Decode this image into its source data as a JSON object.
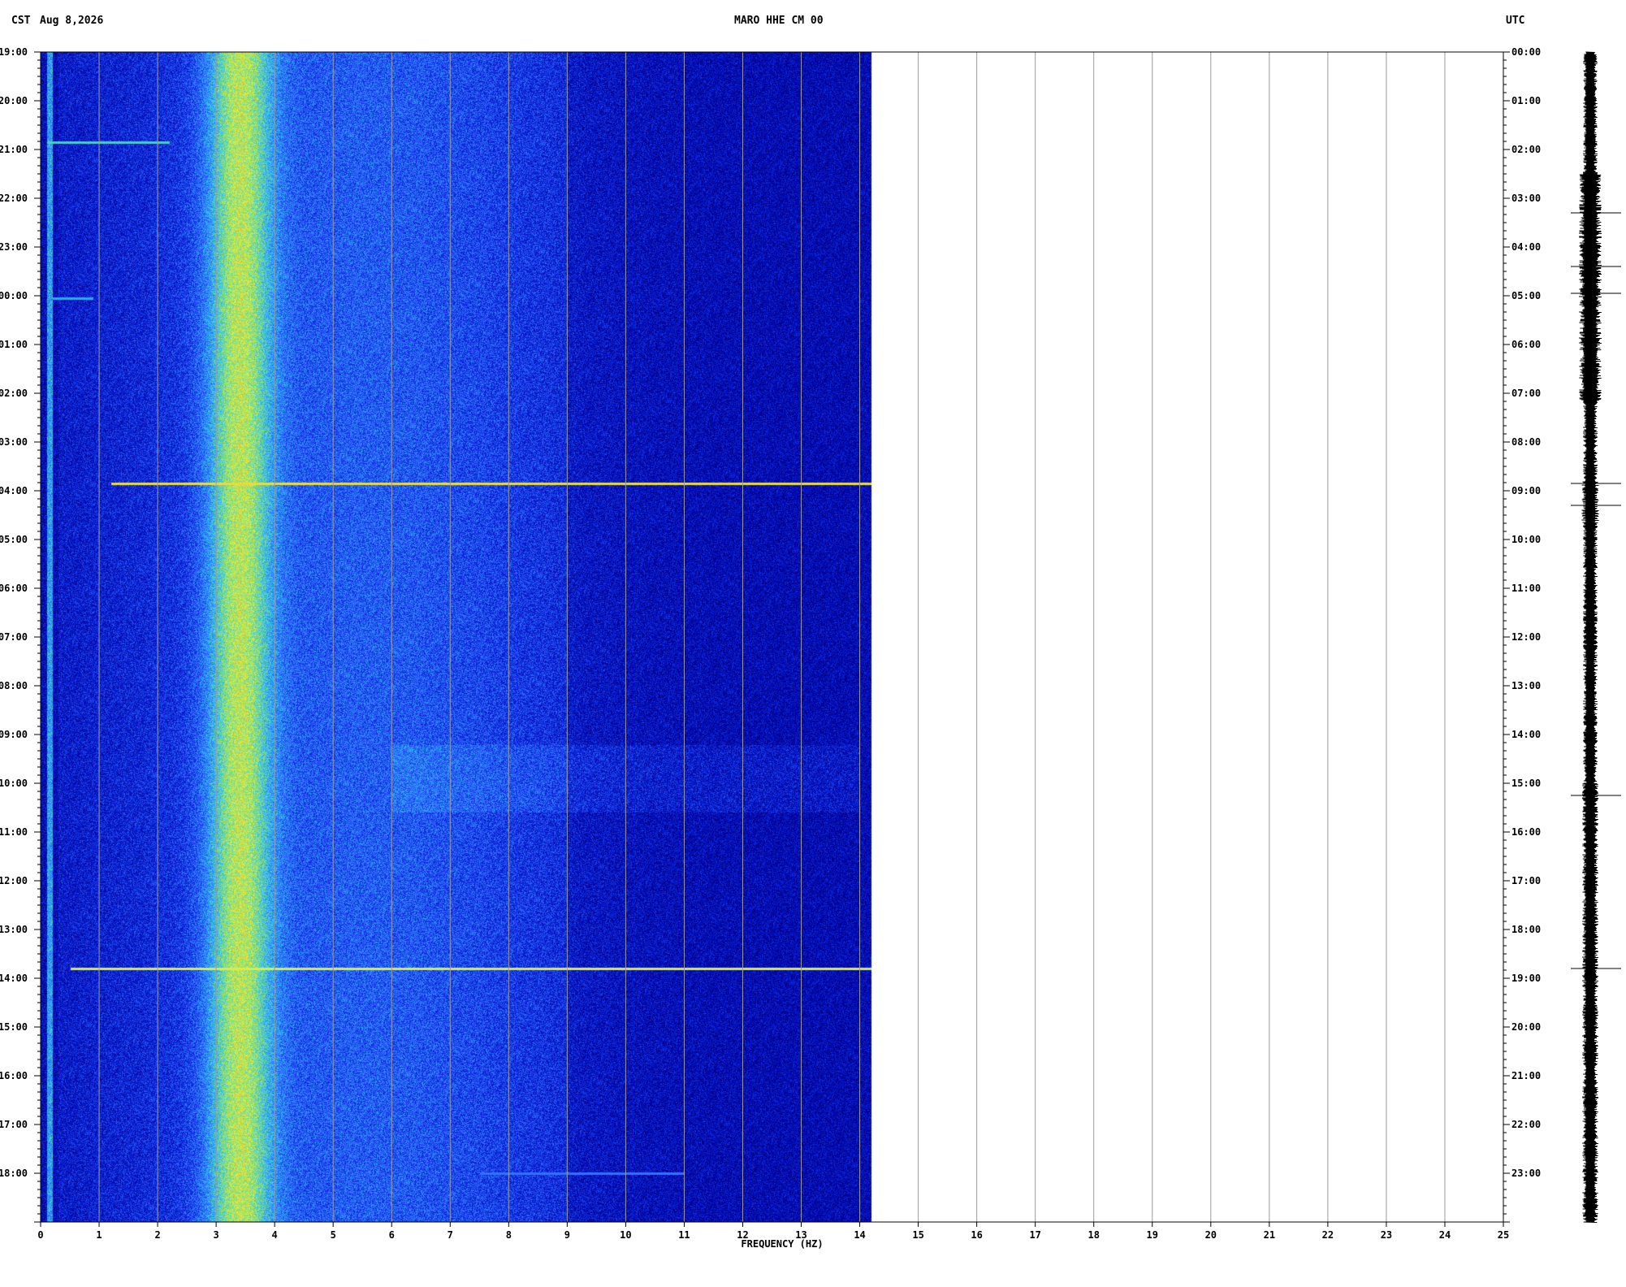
{
  "header": {
    "left_timezone": "CST",
    "date": "Aug 8,2026",
    "station": "MARO HHE CM 00",
    "right_timezone": "UTC"
  },
  "colors": {
    "background": "#ffffff",
    "axis": "#000000",
    "grid": "#9a9a9a",
    "colormap": [
      "#00008c",
      "#0a1fd8",
      "#2f6bff",
      "#30c0f0",
      "#8fe070",
      "#e8f040",
      "#ff2a10"
    ]
  },
  "chart_data": {
    "type": "heatmap",
    "subtype": "spectrogram",
    "title": "MARO HHE CM 00",
    "xlabel": "FREQUENCY (HZ)",
    "x_range": [
      0,
      25
    ],
    "x_ticks": [
      0,
      1,
      2,
      3,
      4,
      5,
      6,
      7,
      8,
      9,
      10,
      11,
      12,
      13,
      14,
      15,
      16,
      17,
      18,
      19,
      20,
      21,
      22,
      23,
      24,
      25
    ],
    "data_max_frequency_hz": 14.2,
    "y_left_label": "CST",
    "y_right_label": "UTC",
    "y_left_ticks": [
      "19:00",
      "20:00",
      "21:00",
      "22:00",
      "23:00",
      "00:00",
      "01:00",
      "02:00",
      "03:00",
      "04:00",
      "05:00",
      "06:00",
      "07:00",
      "08:00",
      "09:00",
      "10:00",
      "11:00",
      "12:00",
      "13:00",
      "14:00",
      "15:00",
      "16:00",
      "17:00",
      "18:00"
    ],
    "y_right_ticks": [
      "00:00",
      "01:00",
      "02:00",
      "03:00",
      "04:00",
      "05:00",
      "06:00",
      "07:00",
      "08:00",
      "09:00",
      "10:00",
      "11:00",
      "12:00",
      "13:00",
      "14:00",
      "15:00",
      "16:00",
      "17:00",
      "18:00",
      "19:00",
      "20:00",
      "21:00",
      "22:00",
      "23:00"
    ],
    "duration_hours": 24,
    "grid_vertical": true,
    "energy_band_hz": {
      "peak": 3.4,
      "low": 2.7,
      "high": 4.3
    },
    "low_freq_line_hz": 0.15,
    "horizontal_events": [
      {
        "hour": 1.85,
        "freq_min": 0.1,
        "freq_max": 2.2,
        "intensity": 0.55
      },
      {
        "hour": 5.05,
        "freq_min": 0.2,
        "freq_max": 0.9,
        "intensity": 0.45
      },
      {
        "hour": 8.85,
        "freq_min": 1.2,
        "freq_max": 14.2,
        "intensity": 0.85
      },
      {
        "hour": 18.8,
        "freq_min": 0.5,
        "freq_max": 14.2,
        "intensity": 0.8
      },
      {
        "hour": 23.0,
        "freq_min": 7.5,
        "freq_max": 11.0,
        "intensity": 0.35
      }
    ],
    "seismogram_spikes_hour": [
      3.3,
      4.4,
      4.95,
      8.85,
      9.3,
      15.25,
      18.8
    ]
  }
}
